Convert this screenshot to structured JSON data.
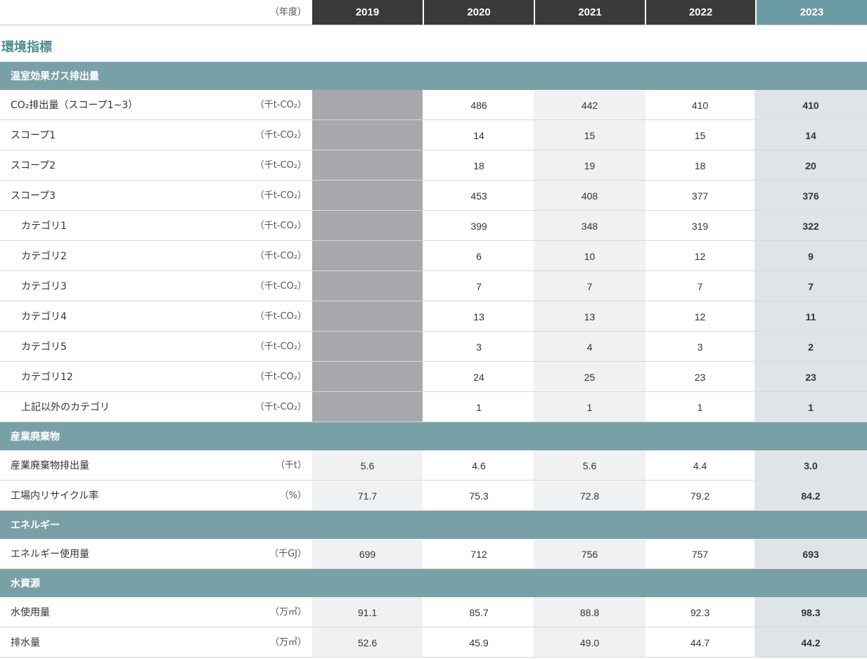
{
  "header": {
    "unit_label": "（年度）",
    "years": [
      "2019",
      "2020",
      "2021",
      "2022",
      "2023"
    ]
  },
  "section_title": "環境指標",
  "categories": {
    "ghg": "温室効果ガス排出量",
    "waste": "産業廃棄物",
    "energy": "エネルギー",
    "water": "水資源"
  },
  "rows": {
    "co2_total": {
      "label": "CO₂排出量（スコープ1~3）",
      "unit": "（千t-CO₂）",
      "values": [
        "",
        "486",
        "442",
        "410",
        "410"
      ]
    },
    "scope1": {
      "label": "スコープ1",
      "unit": "（千t-CO₂）",
      "values": [
        "",
        "14",
        "15",
        "15",
        "14"
      ]
    },
    "scope2": {
      "label": "スコープ2",
      "unit": "（千t-CO₂）",
      "values": [
        "",
        "18",
        "19",
        "18",
        "20"
      ]
    },
    "scope3": {
      "label": "スコープ3",
      "unit": "（千t-CO₂）",
      "values": [
        "",
        "453",
        "408",
        "377",
        "376"
      ]
    },
    "cat1": {
      "label": "カテゴリ1",
      "unit": "（千t-CO₂）",
      "values": [
        "",
        "399",
        "348",
        "319",
        "322"
      ]
    },
    "cat2": {
      "label": "カテゴリ2",
      "unit": "（千t-CO₂）",
      "values": [
        "",
        "6",
        "10",
        "12",
        "9"
      ]
    },
    "cat3": {
      "label": "カテゴリ3",
      "unit": "（千t-CO₂）",
      "values": [
        "",
        "7",
        "7",
        "7",
        "7"
      ]
    },
    "cat4": {
      "label": "カテゴリ4",
      "unit": "（千t-CO₂）",
      "values": [
        "",
        "13",
        "13",
        "12",
        "11"
      ]
    },
    "cat5": {
      "label": "カテゴリ5",
      "unit": "（千t-CO₂）",
      "values": [
        "",
        "3",
        "4",
        "3",
        "2"
      ]
    },
    "cat12": {
      "label": "カテゴリ12",
      "unit": "（千t-CO₂）",
      "values": [
        "",
        "24",
        "25",
        "23",
        "23"
      ]
    },
    "cat_other": {
      "label": "上記以外のカテゴリ",
      "unit": "（千t-CO₂）",
      "values": [
        "",
        "1",
        "1",
        "1",
        "1"
      ]
    },
    "waste_emission": {
      "label": "産業廃棄物排出量",
      "unit": "（千t）",
      "values": [
        "5.6",
        "4.6",
        "5.6",
        "4.4",
        "3.0"
      ]
    },
    "recycle_rate": {
      "label": "工場内リサイクル率",
      "unit": "（%）",
      "values": [
        "71.7",
        "75.3",
        "72.8",
        "79.2",
        "84.2"
      ]
    },
    "energy_use": {
      "label": "エネルギー使用量",
      "unit": "（千GJ）",
      "values": [
        "699",
        "712",
        "756",
        "757",
        "693"
      ]
    },
    "water_use": {
      "label": "水使用量",
      "unit": "（万㎥）",
      "values": [
        "91.1",
        "85.7",
        "88.8",
        "92.3",
        "98.3"
      ]
    },
    "drainage": {
      "label": "排水量",
      "unit": "（万㎥）",
      "values": [
        "52.6",
        "45.9",
        "49.0",
        "44.7",
        "44.2"
      ]
    }
  },
  "colors": {
    "year_header_dark": "#3a3a3a",
    "year_header_current": "#6a9aa2",
    "category_bar": "#7aa0a7",
    "section_title": "#4f8a94",
    "current_year_cell": "#dfe5e6",
    "alt_cell": "#f0f1f2",
    "no_data_cell": "#a7a8ab"
  }
}
